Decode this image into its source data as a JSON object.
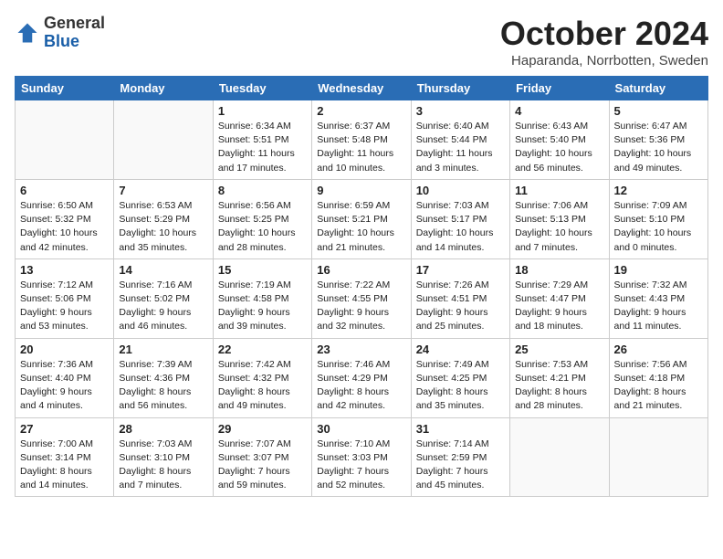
{
  "header": {
    "logo_general": "General",
    "logo_blue": "Blue",
    "month_title": "October 2024",
    "location": "Haparanda, Norrbotten, Sweden"
  },
  "weekdays": [
    "Sunday",
    "Monday",
    "Tuesday",
    "Wednesday",
    "Thursday",
    "Friday",
    "Saturday"
  ],
  "weeks": [
    [
      {
        "day": "",
        "info": ""
      },
      {
        "day": "",
        "info": ""
      },
      {
        "day": "1",
        "info": "Sunrise: 6:34 AM\nSunset: 5:51 PM\nDaylight: 11 hours\nand 17 minutes."
      },
      {
        "day": "2",
        "info": "Sunrise: 6:37 AM\nSunset: 5:48 PM\nDaylight: 11 hours\nand 10 minutes."
      },
      {
        "day": "3",
        "info": "Sunrise: 6:40 AM\nSunset: 5:44 PM\nDaylight: 11 hours\nand 3 minutes."
      },
      {
        "day": "4",
        "info": "Sunrise: 6:43 AM\nSunset: 5:40 PM\nDaylight: 10 hours\nand 56 minutes."
      },
      {
        "day": "5",
        "info": "Sunrise: 6:47 AM\nSunset: 5:36 PM\nDaylight: 10 hours\nand 49 minutes."
      }
    ],
    [
      {
        "day": "6",
        "info": "Sunrise: 6:50 AM\nSunset: 5:32 PM\nDaylight: 10 hours\nand 42 minutes."
      },
      {
        "day": "7",
        "info": "Sunrise: 6:53 AM\nSunset: 5:29 PM\nDaylight: 10 hours\nand 35 minutes."
      },
      {
        "day": "8",
        "info": "Sunrise: 6:56 AM\nSunset: 5:25 PM\nDaylight: 10 hours\nand 28 minutes."
      },
      {
        "day": "9",
        "info": "Sunrise: 6:59 AM\nSunset: 5:21 PM\nDaylight: 10 hours\nand 21 minutes."
      },
      {
        "day": "10",
        "info": "Sunrise: 7:03 AM\nSunset: 5:17 PM\nDaylight: 10 hours\nand 14 minutes."
      },
      {
        "day": "11",
        "info": "Sunrise: 7:06 AM\nSunset: 5:13 PM\nDaylight: 10 hours\nand 7 minutes."
      },
      {
        "day": "12",
        "info": "Sunrise: 7:09 AM\nSunset: 5:10 PM\nDaylight: 10 hours\nand 0 minutes."
      }
    ],
    [
      {
        "day": "13",
        "info": "Sunrise: 7:12 AM\nSunset: 5:06 PM\nDaylight: 9 hours\nand 53 minutes."
      },
      {
        "day": "14",
        "info": "Sunrise: 7:16 AM\nSunset: 5:02 PM\nDaylight: 9 hours\nand 46 minutes."
      },
      {
        "day": "15",
        "info": "Sunrise: 7:19 AM\nSunset: 4:58 PM\nDaylight: 9 hours\nand 39 minutes."
      },
      {
        "day": "16",
        "info": "Sunrise: 7:22 AM\nSunset: 4:55 PM\nDaylight: 9 hours\nand 32 minutes."
      },
      {
        "day": "17",
        "info": "Sunrise: 7:26 AM\nSunset: 4:51 PM\nDaylight: 9 hours\nand 25 minutes."
      },
      {
        "day": "18",
        "info": "Sunrise: 7:29 AM\nSunset: 4:47 PM\nDaylight: 9 hours\nand 18 minutes."
      },
      {
        "day": "19",
        "info": "Sunrise: 7:32 AM\nSunset: 4:43 PM\nDaylight: 9 hours\nand 11 minutes."
      }
    ],
    [
      {
        "day": "20",
        "info": "Sunrise: 7:36 AM\nSunset: 4:40 PM\nDaylight: 9 hours\nand 4 minutes."
      },
      {
        "day": "21",
        "info": "Sunrise: 7:39 AM\nSunset: 4:36 PM\nDaylight: 8 hours\nand 56 minutes."
      },
      {
        "day": "22",
        "info": "Sunrise: 7:42 AM\nSunset: 4:32 PM\nDaylight: 8 hours\nand 49 minutes."
      },
      {
        "day": "23",
        "info": "Sunrise: 7:46 AM\nSunset: 4:29 PM\nDaylight: 8 hours\nand 42 minutes."
      },
      {
        "day": "24",
        "info": "Sunrise: 7:49 AM\nSunset: 4:25 PM\nDaylight: 8 hours\nand 35 minutes."
      },
      {
        "day": "25",
        "info": "Sunrise: 7:53 AM\nSunset: 4:21 PM\nDaylight: 8 hours\nand 28 minutes."
      },
      {
        "day": "26",
        "info": "Sunrise: 7:56 AM\nSunset: 4:18 PM\nDaylight: 8 hours\nand 21 minutes."
      }
    ],
    [
      {
        "day": "27",
        "info": "Sunrise: 7:00 AM\nSunset: 3:14 PM\nDaylight: 8 hours\nand 14 minutes."
      },
      {
        "day": "28",
        "info": "Sunrise: 7:03 AM\nSunset: 3:10 PM\nDaylight: 8 hours\nand 7 minutes."
      },
      {
        "day": "29",
        "info": "Sunrise: 7:07 AM\nSunset: 3:07 PM\nDaylight: 7 hours\nand 59 minutes."
      },
      {
        "day": "30",
        "info": "Sunrise: 7:10 AM\nSunset: 3:03 PM\nDaylight: 7 hours\nand 52 minutes."
      },
      {
        "day": "31",
        "info": "Sunrise: 7:14 AM\nSunset: 2:59 PM\nDaylight: 7 hours\nand 45 minutes."
      },
      {
        "day": "",
        "info": ""
      },
      {
        "day": "",
        "info": ""
      }
    ]
  ]
}
